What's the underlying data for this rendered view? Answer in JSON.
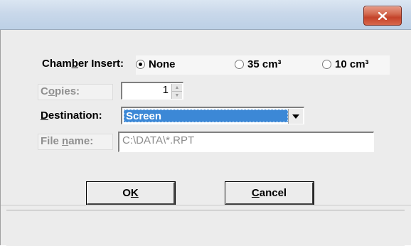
{
  "window": {
    "close_glyph": "X"
  },
  "chamber": {
    "label_pre": "Cham",
    "label_ul": "b",
    "label_post": "er Insert:",
    "options": [
      {
        "label": "None",
        "checked": true
      },
      {
        "label": "35 cm³",
        "checked": false
      },
      {
        "label": "10 cm³",
        "checked": false
      }
    ]
  },
  "copies": {
    "label_pre": "C",
    "label_ul": "o",
    "label_post": "pies:",
    "value": "1"
  },
  "destination": {
    "label_pre": "",
    "label_ul": "D",
    "label_post": "estination:",
    "selected": "Screen"
  },
  "file_name": {
    "label_pre": "File ",
    "label_ul": "n",
    "label_post": "ame:",
    "value": "C:\\DATA\\*.RPT"
  },
  "buttons": {
    "ok_pre": "O",
    "ok_ul": "K",
    "ok_post": "",
    "cancel_pre": "",
    "cancel_ul": "C",
    "cancel_post": "ancel"
  },
  "icons": {
    "close": "close-icon",
    "spin_up": "arrow-up-icon",
    "spin_down": "arrow-down-icon",
    "dropdown": "chevron-down-icon"
  }
}
